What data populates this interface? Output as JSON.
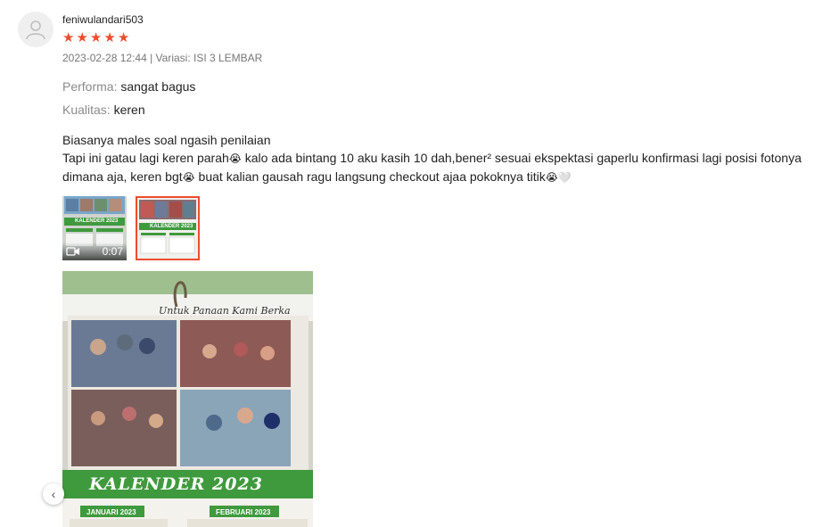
{
  "review": {
    "username": "feniwulandari503",
    "rating": 5,
    "meta": "2023-02-28 12:44 | Variasi: ISI 3 LEMBAR",
    "attributes": [
      {
        "label": "Performa:",
        "value": "sangat bagus"
      },
      {
        "label": "Kualitas:",
        "value": "keren"
      }
    ],
    "comment": {
      "line1": "Biasanya males soal ngasih penilaian",
      "line2a": "Tapi ini gatau lagi keren parah",
      "line2b": " kalo ada bintang 10 aku kasih 10 dah,bener² sesuai ekspektasi gaperlu konfirmasi lagi posisi fotonya",
      "line3a": "dimana aja, keren bgt",
      "line3b": " buat kalian gausah ragu langsung checkout ajaa pokoknya titik",
      "emoji_cry": "😭",
      "emoji_heart": "🤍"
    },
    "media": {
      "video_duration": "0:07",
      "calendar_title": "KALENDER 2023",
      "calendar_small_title": "KALENDER 2023",
      "banner_text": "Untuk Panaan Kami Berka",
      "month1": "JANUARI 2023",
      "month2": "FEBRUARI 2023"
    },
    "colors": {
      "accent": "#ee4d2d",
      "calendar_green": "#3f9a3d"
    }
  }
}
